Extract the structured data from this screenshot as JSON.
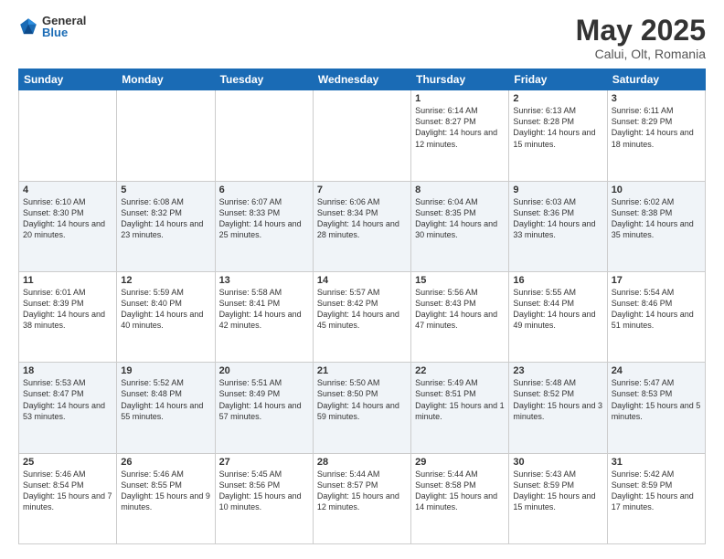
{
  "logo": {
    "general": "General",
    "blue": "Blue"
  },
  "title": "May 2025",
  "location": "Calui, Olt, Romania",
  "days_of_week": [
    "Sunday",
    "Monday",
    "Tuesday",
    "Wednesday",
    "Thursday",
    "Friday",
    "Saturday"
  ],
  "weeks": [
    [
      {
        "day": "",
        "content": ""
      },
      {
        "day": "",
        "content": ""
      },
      {
        "day": "",
        "content": ""
      },
      {
        "day": "",
        "content": ""
      },
      {
        "day": "1",
        "content": "Sunrise: 6:14 AM\nSunset: 8:27 PM\nDaylight: 14 hours\nand 12 minutes."
      },
      {
        "day": "2",
        "content": "Sunrise: 6:13 AM\nSunset: 8:28 PM\nDaylight: 14 hours\nand 15 minutes."
      },
      {
        "day": "3",
        "content": "Sunrise: 6:11 AM\nSunset: 8:29 PM\nDaylight: 14 hours\nand 18 minutes."
      }
    ],
    [
      {
        "day": "4",
        "content": "Sunrise: 6:10 AM\nSunset: 8:30 PM\nDaylight: 14 hours\nand 20 minutes."
      },
      {
        "day": "5",
        "content": "Sunrise: 6:08 AM\nSunset: 8:32 PM\nDaylight: 14 hours\nand 23 minutes."
      },
      {
        "day": "6",
        "content": "Sunrise: 6:07 AM\nSunset: 8:33 PM\nDaylight: 14 hours\nand 25 minutes."
      },
      {
        "day": "7",
        "content": "Sunrise: 6:06 AM\nSunset: 8:34 PM\nDaylight: 14 hours\nand 28 minutes."
      },
      {
        "day": "8",
        "content": "Sunrise: 6:04 AM\nSunset: 8:35 PM\nDaylight: 14 hours\nand 30 minutes."
      },
      {
        "day": "9",
        "content": "Sunrise: 6:03 AM\nSunset: 8:36 PM\nDaylight: 14 hours\nand 33 minutes."
      },
      {
        "day": "10",
        "content": "Sunrise: 6:02 AM\nSunset: 8:38 PM\nDaylight: 14 hours\nand 35 minutes."
      }
    ],
    [
      {
        "day": "11",
        "content": "Sunrise: 6:01 AM\nSunset: 8:39 PM\nDaylight: 14 hours\nand 38 minutes."
      },
      {
        "day": "12",
        "content": "Sunrise: 5:59 AM\nSunset: 8:40 PM\nDaylight: 14 hours\nand 40 minutes."
      },
      {
        "day": "13",
        "content": "Sunrise: 5:58 AM\nSunset: 8:41 PM\nDaylight: 14 hours\nand 42 minutes."
      },
      {
        "day": "14",
        "content": "Sunrise: 5:57 AM\nSunset: 8:42 PM\nDaylight: 14 hours\nand 45 minutes."
      },
      {
        "day": "15",
        "content": "Sunrise: 5:56 AM\nSunset: 8:43 PM\nDaylight: 14 hours\nand 47 minutes."
      },
      {
        "day": "16",
        "content": "Sunrise: 5:55 AM\nSunset: 8:44 PM\nDaylight: 14 hours\nand 49 minutes."
      },
      {
        "day": "17",
        "content": "Sunrise: 5:54 AM\nSunset: 8:46 PM\nDaylight: 14 hours\nand 51 minutes."
      }
    ],
    [
      {
        "day": "18",
        "content": "Sunrise: 5:53 AM\nSunset: 8:47 PM\nDaylight: 14 hours\nand 53 minutes."
      },
      {
        "day": "19",
        "content": "Sunrise: 5:52 AM\nSunset: 8:48 PM\nDaylight: 14 hours\nand 55 minutes."
      },
      {
        "day": "20",
        "content": "Sunrise: 5:51 AM\nSunset: 8:49 PM\nDaylight: 14 hours\nand 57 minutes."
      },
      {
        "day": "21",
        "content": "Sunrise: 5:50 AM\nSunset: 8:50 PM\nDaylight: 14 hours\nand 59 minutes."
      },
      {
        "day": "22",
        "content": "Sunrise: 5:49 AM\nSunset: 8:51 PM\nDaylight: 15 hours\nand 1 minute."
      },
      {
        "day": "23",
        "content": "Sunrise: 5:48 AM\nSunset: 8:52 PM\nDaylight: 15 hours\nand 3 minutes."
      },
      {
        "day": "24",
        "content": "Sunrise: 5:47 AM\nSunset: 8:53 PM\nDaylight: 15 hours\nand 5 minutes."
      }
    ],
    [
      {
        "day": "25",
        "content": "Sunrise: 5:46 AM\nSunset: 8:54 PM\nDaylight: 15 hours\nand 7 minutes."
      },
      {
        "day": "26",
        "content": "Sunrise: 5:46 AM\nSunset: 8:55 PM\nDaylight: 15 hours\nand 9 minutes."
      },
      {
        "day": "27",
        "content": "Sunrise: 5:45 AM\nSunset: 8:56 PM\nDaylight: 15 hours\nand 10 minutes."
      },
      {
        "day": "28",
        "content": "Sunrise: 5:44 AM\nSunset: 8:57 PM\nDaylight: 15 hours\nand 12 minutes."
      },
      {
        "day": "29",
        "content": "Sunrise: 5:44 AM\nSunset: 8:58 PM\nDaylight: 15 hours\nand 14 minutes."
      },
      {
        "day": "30",
        "content": "Sunrise: 5:43 AM\nSunset: 8:59 PM\nDaylight: 15 hours\nand 15 minutes."
      },
      {
        "day": "31",
        "content": "Sunrise: 5:42 AM\nSunset: 8:59 PM\nDaylight: 15 hours\nand 17 minutes."
      }
    ]
  ]
}
